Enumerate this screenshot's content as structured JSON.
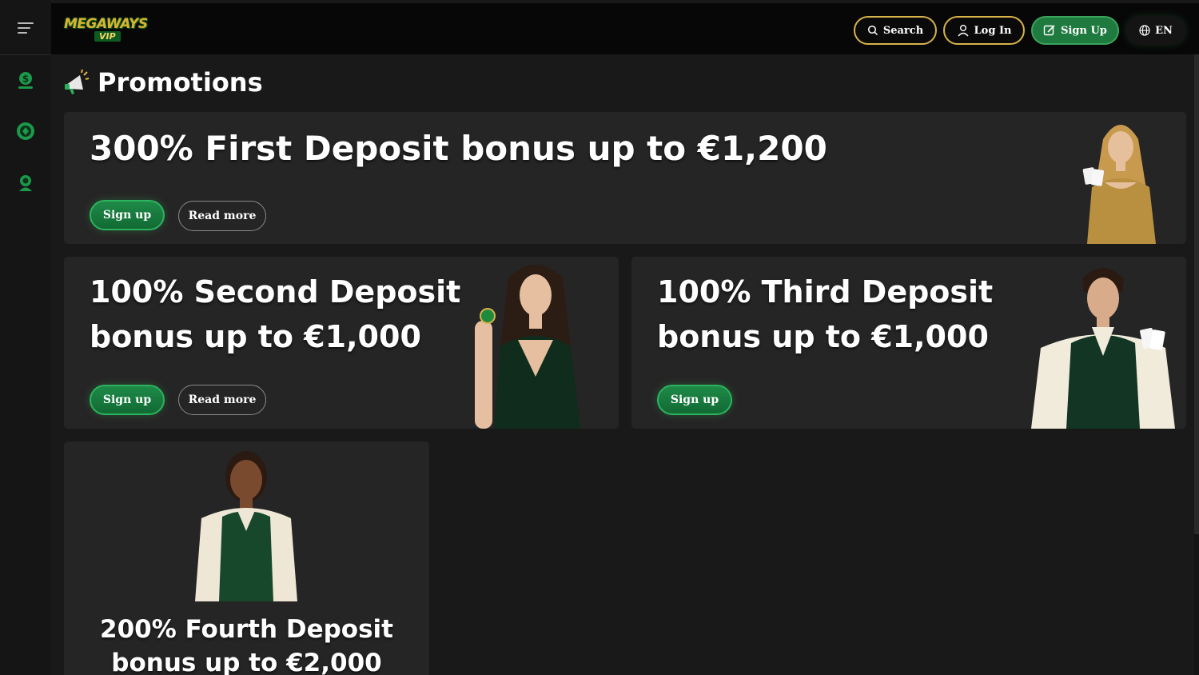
{
  "header": {
    "logo_text": "MEGAWAYS",
    "logo_sub": "VIP",
    "search_label": "Search",
    "login_label": "Log In",
    "signup_label": "Sign Up",
    "language_label": "EN"
  },
  "sidebar": {
    "items": [
      {
        "icon": "money-bag-icon"
      },
      {
        "icon": "casino-chip-icon"
      },
      {
        "icon": "support-agent-icon"
      }
    ]
  },
  "page": {
    "title": "Promotions"
  },
  "promotions": [
    {
      "title": "300% First Deposit bonus up to €1,200",
      "primary": "Sign up",
      "secondary": "Read more"
    },
    {
      "title": "100% Second Deposit bonus up to €1,000",
      "primary": "Sign up",
      "secondary": "Read more"
    },
    {
      "title": "100% Third Deposit bonus up to €1,000",
      "primary": "Sign up"
    },
    {
      "title": "200% Fourth Deposit bonus up to €2,000"
    }
  ],
  "colors": {
    "accent_green": "#1f7a3f",
    "accent_gold": "#d9b24a",
    "background": "#1a1919",
    "card": "#262525"
  }
}
